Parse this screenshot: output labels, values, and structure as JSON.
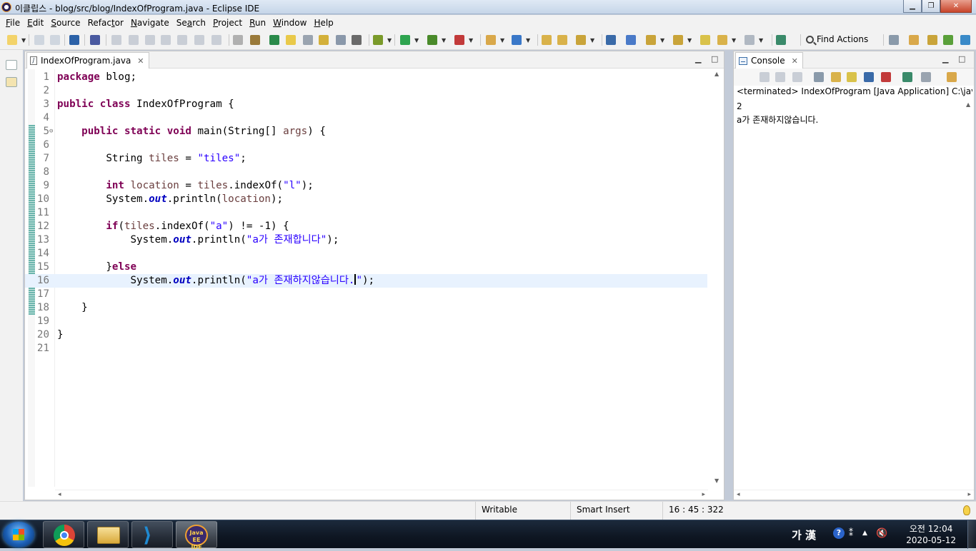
{
  "window": {
    "title": "이클립스 - blog/src/blog/IndexOfProgram.java - Eclipse IDE"
  },
  "menu": [
    {
      "key": "F",
      "rest": "ile"
    },
    {
      "key": "E",
      "rest": "dit"
    },
    {
      "key": "S",
      "rest": "ource"
    },
    {
      "pre": "Refac",
      "key": "t",
      "rest": "or"
    },
    {
      "key": "N",
      "rest": "avigate"
    },
    {
      "pre": "Se",
      "key": "a",
      "rest": "rch"
    },
    {
      "key": "P",
      "rest": "roject"
    },
    {
      "key": "R",
      "rest": "un"
    },
    {
      "key": "W",
      "rest": "indow"
    },
    {
      "key": "H",
      "rest": "elp"
    }
  ],
  "toolbar": {
    "find_actions": "Find Actions"
  },
  "editor": {
    "tab_label": "IndexOfProgram.java",
    "current_line": 16,
    "lines": [
      {
        "n": "1",
        "tokens": [
          {
            "t": "package",
            "c": "kw"
          },
          {
            "t": " blog;"
          }
        ]
      },
      {
        "n": "2",
        "tokens": []
      },
      {
        "n": "3",
        "tokens": [
          {
            "t": "public",
            "c": "kw"
          },
          {
            "t": " "
          },
          {
            "t": "class",
            "c": "kw"
          },
          {
            "t": " IndexOfProgram {"
          }
        ]
      },
      {
        "n": "4",
        "tokens": []
      },
      {
        "n": "5",
        "fold": true,
        "tokens": [
          {
            "t": "    "
          },
          {
            "t": "public",
            "c": "kw"
          },
          {
            "t": " "
          },
          {
            "t": "static",
            "c": "kw"
          },
          {
            "t": " "
          },
          {
            "t": "void",
            "c": "kw"
          },
          {
            "t": " main(String[] "
          },
          {
            "t": "args",
            "c": "var"
          },
          {
            "t": ") {"
          }
        ]
      },
      {
        "n": "6",
        "tokens": []
      },
      {
        "n": "7",
        "tokens": [
          {
            "t": "        String "
          },
          {
            "t": "tiles",
            "c": "var"
          },
          {
            "t": " = "
          },
          {
            "t": "\"tiles\"",
            "c": "str"
          },
          {
            "t": ";"
          }
        ]
      },
      {
        "n": "8",
        "tokens": []
      },
      {
        "n": "9",
        "tokens": [
          {
            "t": "        "
          },
          {
            "t": "int",
            "c": "kw"
          },
          {
            "t": " "
          },
          {
            "t": "location",
            "c": "var"
          },
          {
            "t": " = "
          },
          {
            "t": "tiles",
            "c": "var"
          },
          {
            "t": ".indexOf("
          },
          {
            "t": "\"l\"",
            "c": "str"
          },
          {
            "t": ");"
          }
        ]
      },
      {
        "n": "10",
        "tokens": [
          {
            "t": "        System."
          },
          {
            "t": "out",
            "c": "fld"
          },
          {
            "t": ".println("
          },
          {
            "t": "location",
            "c": "var"
          },
          {
            "t": ");"
          }
        ]
      },
      {
        "n": "11",
        "tokens": []
      },
      {
        "n": "12",
        "tokens": [
          {
            "t": "        "
          },
          {
            "t": "if",
            "c": "kw"
          },
          {
            "t": "("
          },
          {
            "t": "tiles",
            "c": "var"
          },
          {
            "t": ".indexOf("
          },
          {
            "t": "\"a\"",
            "c": "str"
          },
          {
            "t": ") != -1) {"
          }
        ]
      },
      {
        "n": "13",
        "tokens": [
          {
            "t": "            System."
          },
          {
            "t": "out",
            "c": "fld"
          },
          {
            "t": ".println("
          },
          {
            "t": "\"a가 존재합니다\"",
            "c": "str"
          },
          {
            "t": ");"
          }
        ]
      },
      {
        "n": "14",
        "tokens": []
      },
      {
        "n": "15",
        "tokens": [
          {
            "t": "        }"
          },
          {
            "t": "else",
            "c": "kw"
          }
        ]
      },
      {
        "n": "16",
        "tokens": [
          {
            "t": "            System."
          },
          {
            "t": "out",
            "c": "fld"
          },
          {
            "t": ".println("
          },
          {
            "t": "\"a가 존재하지않습니다.",
            "c": "str"
          },
          {
            "t": "",
            "caret": true
          },
          {
            "t": "\"",
            "c": "str"
          },
          {
            "t": ");"
          }
        ]
      },
      {
        "n": "17",
        "tokens": []
      },
      {
        "n": "18",
        "tokens": [
          {
            "t": "    }"
          }
        ]
      },
      {
        "n": "19",
        "tokens": []
      },
      {
        "n": "20",
        "tokens": [
          {
            "t": "}"
          }
        ]
      },
      {
        "n": "21",
        "tokens": []
      }
    ]
  },
  "console": {
    "tab_label": "Console",
    "status": "<terminated> IndexOfProgram [Java Application] C:\\java\\bin",
    "output": [
      "2",
      "a가 존재하지않습니다."
    ]
  },
  "status": {
    "writable": "Writable",
    "insert_mode": "Smart Insert",
    "position": "16 : 45 : 322"
  },
  "taskbar": {
    "lang": "가 漢",
    "time": "오전 12:04",
    "date": "2020-05-12",
    "java_label": "Java EE IDE"
  }
}
